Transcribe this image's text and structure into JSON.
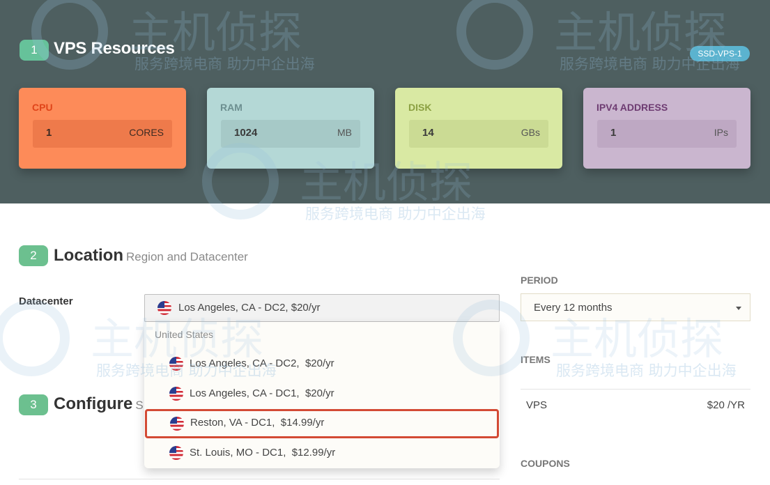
{
  "section1": {
    "step": "1",
    "title": "VPS Resources",
    "plan_badge": "SSD-VPS-1"
  },
  "resources": [
    {
      "label": "CPU",
      "value": "1",
      "unit": "CORES"
    },
    {
      "label": "RAM",
      "value": "1024",
      "unit": "MB"
    },
    {
      "label": "DISK",
      "value": "14",
      "unit": "GBs"
    },
    {
      "label": "IPV4 ADDRESS",
      "value": "1",
      "unit": "IPs"
    }
  ],
  "section2": {
    "step": "2",
    "title": "Location",
    "subtitle": "Region and Datacenter"
  },
  "datacenter": {
    "label": "Datacenter",
    "selected": "Los Angeles, CA - DC2, $20/yr",
    "group": "United States",
    "options": [
      {
        "name": "Los Angeles, CA - DC2,",
        "price": "$20/yr"
      },
      {
        "name": "Los Angeles, CA - DC1,",
        "price": "$20/yr"
      },
      {
        "name": "Reston, VA - DC1,",
        "price": "$14.99/yr"
      },
      {
        "name": "St. Louis, MO - DC1,",
        "price": "$12.99/yr"
      }
    ]
  },
  "section3": {
    "step": "3",
    "title": "Configure",
    "subtitle_fragment": "S"
  },
  "sidebar": {
    "period_label": "PERIOD",
    "period_value": "Every 12 months",
    "items_label": "ITEMS",
    "item_name": "VPS",
    "item_price": "$20 /YR",
    "coupons_label": "COUPONS"
  },
  "watermark": {
    "brand": "主机侦探",
    "tagline": "服务跨境电商 助力中企出海"
  },
  "colors": {
    "top_band": "#4e5f60",
    "cpu": "#fd8b59",
    "ram": "#b4d8d6",
    "disk": "#d9e9a3",
    "ipv4": "#cab6cf",
    "step_badge": "#6cc08f",
    "highlight": "#d34a35"
  }
}
